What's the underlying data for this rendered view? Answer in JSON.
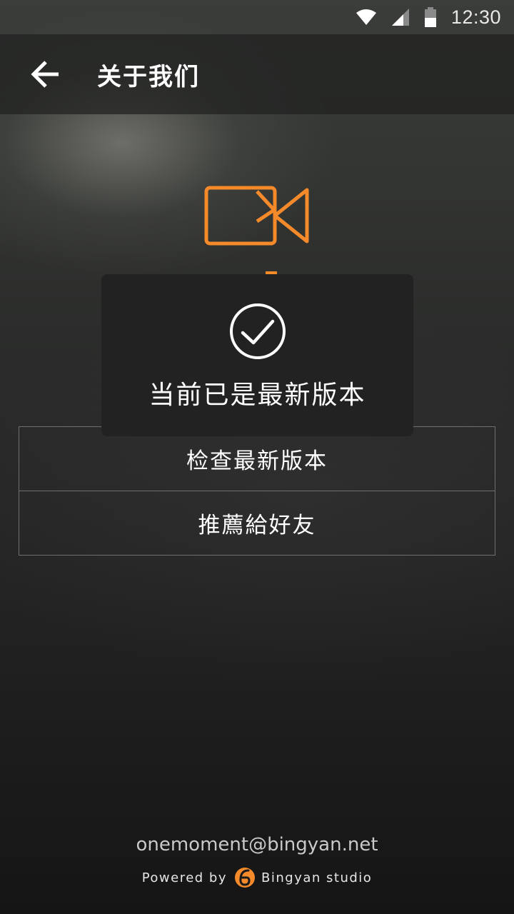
{
  "status_bar": {
    "time": "12:30",
    "icons": [
      "wifi-icon",
      "signal-icon",
      "battery-icon"
    ]
  },
  "app_bar": {
    "back_icon": "arrow-left-icon",
    "title": "关于我们"
  },
  "logo": {
    "icon": "video-camera-icon",
    "color": "#f58a2b"
  },
  "actions": [
    {
      "label": "检查最新版本"
    },
    {
      "label": "推薦給好友"
    }
  ],
  "toast": {
    "icon": "check-circle-icon",
    "message": "当前已是最新版本"
  },
  "footer": {
    "email": "onemoment@bingyan.net",
    "powered_prefix": "Powered by",
    "brand_name": "Bingyan studio",
    "brand_icon": "bingyan-logo-icon",
    "brand_color": "#f58a2b"
  },
  "colors": {
    "accent": "#f58a2b",
    "toast_bg": "#222222",
    "divider": "#6f6f6f"
  }
}
